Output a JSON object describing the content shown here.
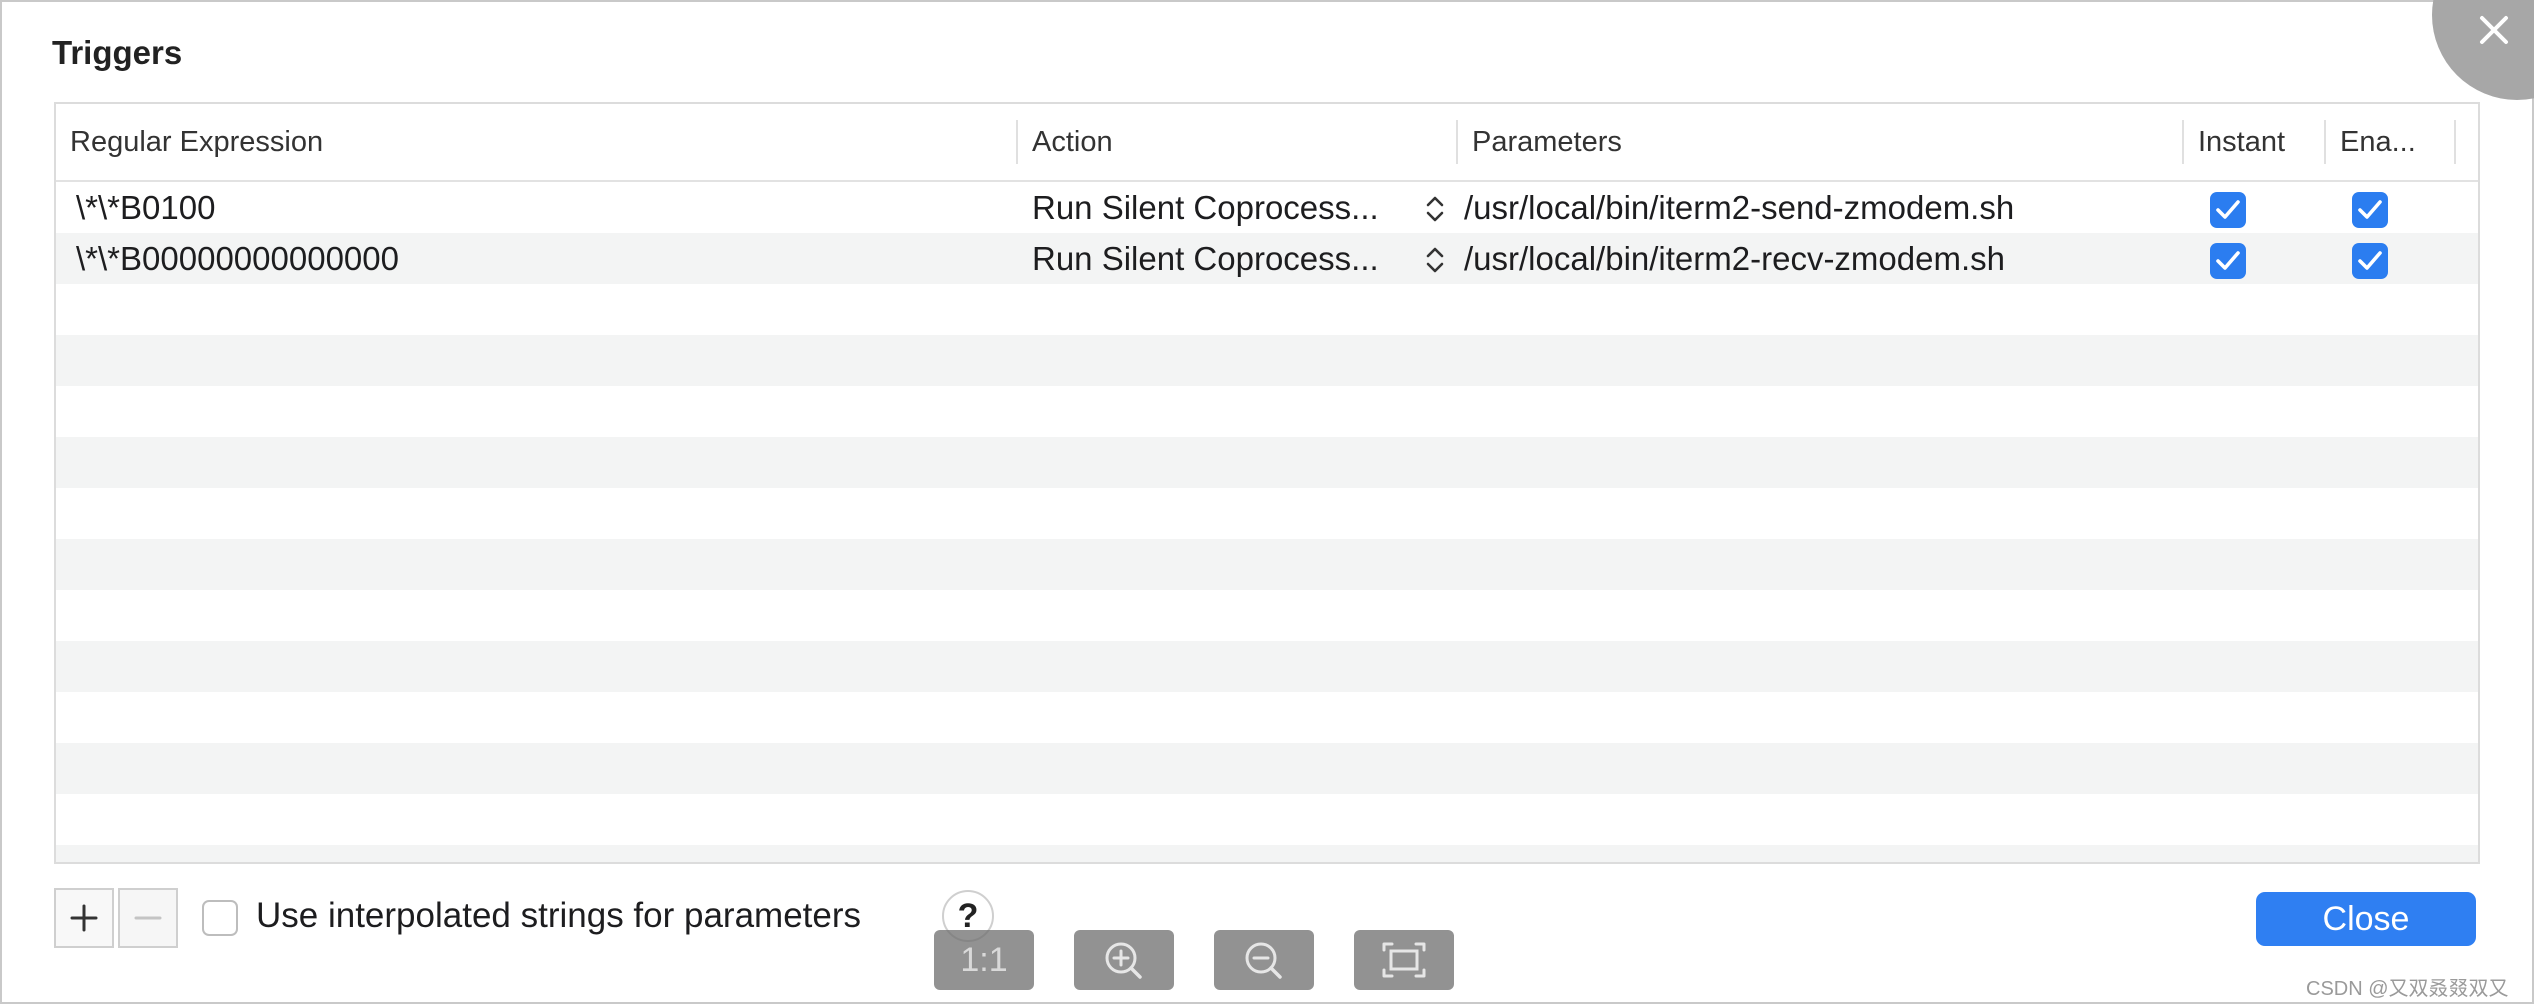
{
  "dialog": {
    "title": "Triggers",
    "close_icon": "close-icon"
  },
  "table": {
    "columns": [
      "Regular Expression",
      "Action",
      "Parameters",
      "Instant",
      "Ena..."
    ],
    "rows": [
      {
        "regex": "\\*\\*B0100",
        "action": "Run Silent Coprocess...",
        "parameters": "/usr/local/bin/iterm2-send-zmodem.sh",
        "instant": true,
        "enabled": true
      },
      {
        "regex": "\\*\\*B00000000000000",
        "action": "Run Silent Coprocess...",
        "parameters": "/usr/local/bin/iterm2-recv-zmodem.sh",
        "instant": true,
        "enabled": true
      }
    ]
  },
  "footer": {
    "add_label": "+",
    "remove_label": "−",
    "interpolated_label": "Use interpolated strings for parameters",
    "interpolated_checked": false,
    "help_label": "?",
    "close_label": "Close"
  },
  "viewer_toolbar": {
    "actual_size_label": "1:1",
    "zoom_in_icon": "zoom-in-icon",
    "zoom_out_icon": "zoom-out-icon",
    "fit_icon": "fit-screen-icon"
  },
  "watermark": "CSDN @又双叒叕双又",
  "colors": {
    "accent": "#2f7ff2",
    "checkbox": "#2b7df0",
    "row_alt": "#f3f4f4"
  }
}
